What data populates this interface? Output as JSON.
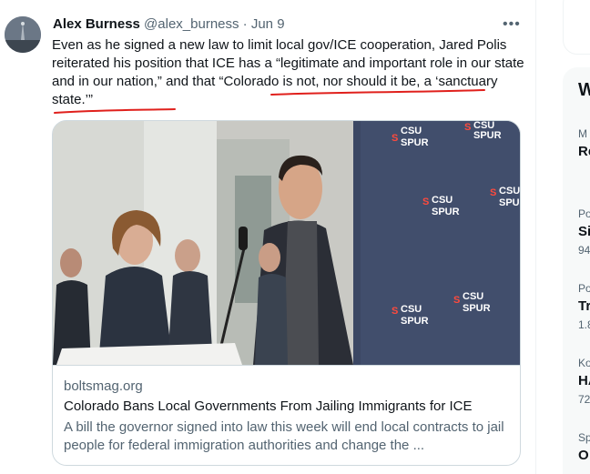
{
  "tweet": {
    "author_name": "Alex Burness",
    "handle": "@alex_burness",
    "date": "Jun 9",
    "text_part1": "Even as he signed a new law to limit local gov/ICE cooperation, Jared Polis reiterated his position that ICE has a “legitimate and important role in our state and in our nation,” and that “",
    "text_highlight": "Colorado is not, nor should it be, a ‘sanctuary state.’",
    "text_part2": "”",
    "more_icon": "more-horizontal-icon",
    "annotation_color": "#e0201c"
  },
  "link_card": {
    "domain": "boltsmag.org",
    "title": "Colorado Bans Local Governments From Jailing Immigrants for ICE",
    "description": "A bill the governor signed into law this week will end local contracts to jail people for federal immigration authorities and change the ...",
    "backdrop_logo_line1": "CSU",
    "backdrop_logo_line2": "SPUR"
  },
  "sidebar": {
    "heading": "W",
    "items": [
      {
        "category": "M",
        "title": "Re",
        "sub": ""
      },
      {
        "category": "Po",
        "title": "Si",
        "sub": "94"
      },
      {
        "category": "Po",
        "title": "Tr",
        "sub": "1.8"
      },
      {
        "category": "Ko",
        "title": "HA",
        "sub": "72"
      },
      {
        "category": "Sp",
        "title": "O",
        "sub": ""
      }
    ]
  }
}
